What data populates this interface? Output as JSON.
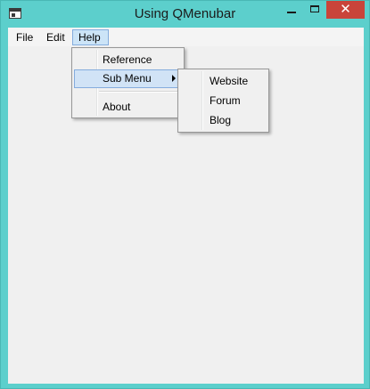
{
  "window": {
    "title": "Using QMenubar",
    "close_glyph": "✕",
    "accent_color": "#5ccfcc",
    "close_color": "#c9443a"
  },
  "menubar": {
    "items": [
      {
        "label": "File"
      },
      {
        "label": "Edit"
      },
      {
        "label": "Help"
      }
    ]
  },
  "help_menu": {
    "items": [
      {
        "label": "Reference"
      },
      {
        "label": "Sub Menu"
      },
      {
        "label": "About"
      }
    ]
  },
  "sub_menu": {
    "items": [
      {
        "label": "Website"
      },
      {
        "label": "Forum"
      },
      {
        "label": "Blog"
      }
    ]
  }
}
